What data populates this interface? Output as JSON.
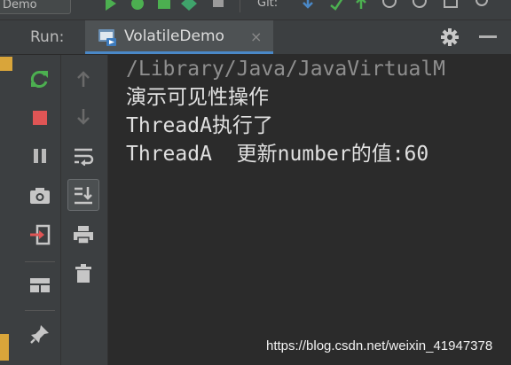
{
  "toolbar": {
    "config_label": "Demo",
    "git_label": "Git:"
  },
  "run_panel": {
    "label": "Run:",
    "tab": {
      "title": "VolatileDemo",
      "close": "×"
    }
  },
  "console": {
    "lines": [
      "/Library/Java/JavaVirtualM",
      "演示可见性操作",
      "ThreadA执行了",
      "ThreadA  更新number的值:60"
    ]
  },
  "watermark": "https://blog.csdn.net/weixin_41947378",
  "colors": {
    "rerun": "#4caf50",
    "stop": "#e05555",
    "accent_tab": "#4a88c7",
    "left_marker": "#d9a53a"
  }
}
